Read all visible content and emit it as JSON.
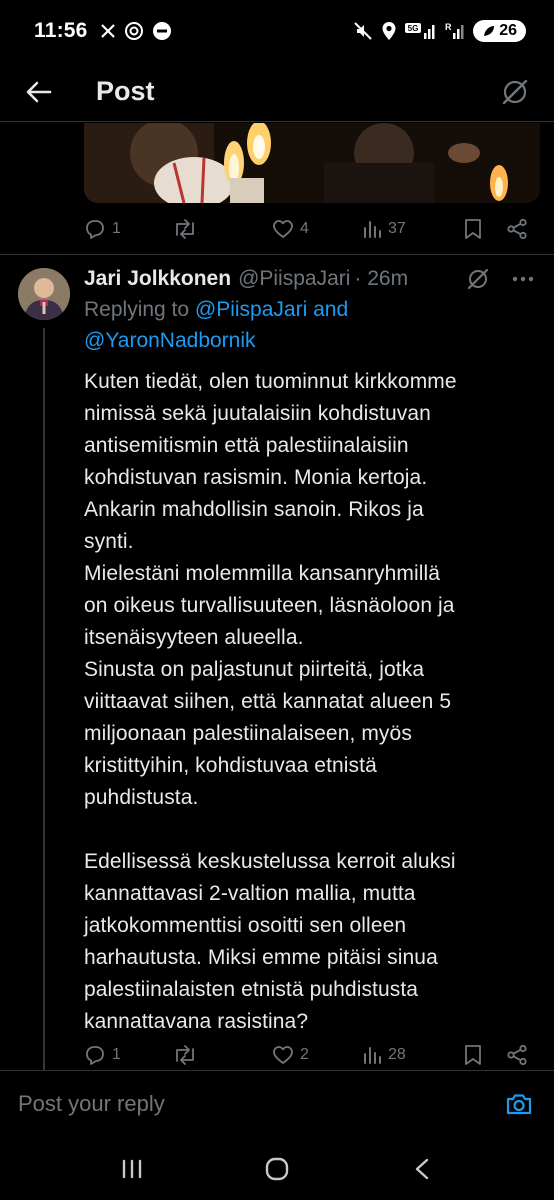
{
  "status_bar": {
    "time": "11:56",
    "battery": "26",
    "network_label": "5G",
    "roaming_label": "R"
  },
  "header": {
    "title": "Post"
  },
  "parent_actions": {
    "replies": "1",
    "reposts": "",
    "likes": "4",
    "views": "37"
  },
  "reply": {
    "author_name": "Jari Jolkkonen",
    "handle": "@PiispaJari",
    "time": "· 26m",
    "replying_to_prefix": "Replying to ",
    "replying_to_mention1": "@PiispaJari",
    "replying_to_and": " and",
    "replying_to_mention2": "@YaronNadbornik",
    "text": "Kuten tiedät, olen tuominnut kirkkomme\nnimissä sekä juutalaisiin kohdistuvan\nantisemitismin että palestiinalaisiin\nkohdistuvan rasismin. Monia kertoja.\nAnkarin mahdollisin sanoin. Rikos ja\nsynti.\nMielestäni molemmilla kansanryhmillä\non oikeus turvallisuuteen, läsnäoloon ja\nitsenäisyyteen alueella.\nSinusta on paljastunut piirteitä, jotka\nviittaavat siihen, että kannatat alueen 5\nmiljoonaan palestiinalaiseen, myös\nkristittyihin, kohdistuvaa etnistä\npuhdistusta.\n\nEdellisessä keskustelussa kerroit aluksi\nkannattavasi 2-valtion mallia, mutta\njatkokommenttisi osoitti sen olleen\nharhautusta. Miksi emme pitäisi sinua\npalestiinalaisten etnistä puhdistusta\nkannattavana rasistina?",
    "actions": {
      "replies": "1",
      "reposts": "",
      "likes": "2",
      "views": "28"
    }
  },
  "composer": {
    "placeholder": "Post your reply"
  },
  "colors": {
    "background": "#000000",
    "text": "#e7e9ea",
    "secondary": "#71767b",
    "accent": "#1d9bf0",
    "border": "#2f3336"
  },
  "icons": [
    "back-arrow-icon",
    "grok-icon",
    "reply-icon",
    "repost-icon",
    "like-icon",
    "views-icon",
    "bookmark-icon",
    "share-icon",
    "camera-icon",
    "recents-icon",
    "home-icon",
    "back-nav-icon"
  ]
}
